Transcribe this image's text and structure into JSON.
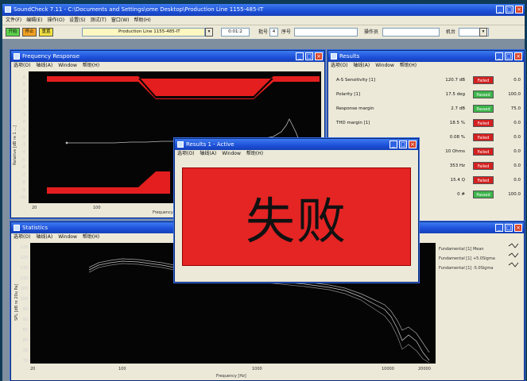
{
  "app": {
    "title": "SoundCheck 7.11 - C:\\Documents and Settings\\ome Desktop\\Production Line 1155-485-IT",
    "menu": [
      "文件(F)",
      "编辑(E)",
      "操作(O)",
      "设置(S)",
      "测试(T)",
      "窗口(W)",
      "帮助(H)"
    ]
  },
  "toolbar": {
    "run_label": "开始",
    "stop_label": "停止",
    "reset_label": "重置",
    "sequence_value": "Production Line 1155-485-IT",
    "time_value": "0:01:2",
    "batch_label": "批号",
    "batch_value": "4",
    "serial_label": "序号",
    "operator_label": "操作员",
    "station_label": "机台"
  },
  "colors": {
    "title_blue": "#1c4fd8",
    "window_bg": "#ece9d8",
    "fail_red": "#d42020",
    "pass_green": "#3bb449",
    "plot_bg": "#050505"
  },
  "freq_window": {
    "title": "Frequency Response",
    "menu": [
      "选项(O)",
      "轴线(A)",
      "Window",
      "帮助(H)"
    ],
    "y_ticks": [
      "6",
      "5",
      "4",
      "3",
      "2",
      "1",
      "0",
      "-1",
      "-2",
      "-3",
      "-4",
      "-5",
      "-6",
      "-7",
      "-8",
      "-9",
      "-10"
    ],
    "x_ticks": [
      "20",
      "100"
    ],
    "ylabel": "Relative [dB re 1 ...]",
    "xlabel": "Frequency"
  },
  "results_window": {
    "title": "Results",
    "menu": [
      "选项(O)",
      "轴线(A)",
      "Window",
      "帮助(H)"
    ],
    "rows": [
      {
        "name": "A-S Sensitivity [1]",
        "value": "120.7 dB",
        "status": "Failed",
        "pct": "0.0",
        "unit": "%"
      },
      {
        "name": "Polarity [1]",
        "value": "17.5 deg",
        "status": "Passed",
        "pct": "100.0",
        "unit": "%"
      },
      {
        "name": "Response margin",
        "value": "2.7 dB",
        "status": "Passed",
        "pct": "75.0",
        "unit": "%"
      },
      {
        "name": "THD margin [1]",
        "value": "18.5 %",
        "status": "Failed",
        "pct": "0.0",
        "unit": "%"
      },
      {
        "name": "",
        "value": "0.08 %",
        "status": "Failed",
        "pct": "0.0",
        "unit": "%"
      },
      {
        "name": "",
        "value": "10 Ohms",
        "status": "Failed",
        "pct": "0.0",
        "unit": "%"
      },
      {
        "name": "",
        "value": "353 Hz",
        "status": "Failed",
        "pct": "0.0",
        "unit": "%"
      },
      {
        "name": "",
        "value": "15.4 Q",
        "status": "Failed",
        "pct": "0.0",
        "unit": "%"
      },
      {
        "name": "",
        "value": "0 #",
        "status": "Passed",
        "pct": "100.0",
        "unit": "%"
      }
    ]
  },
  "stats_window": {
    "title": "Statistics",
    "menu": [
      "选项(O)",
      "轴线(A)",
      "Window",
      "帮助(H)"
    ],
    "y_ticks": [
      "125",
      "120",
      "115",
      "110",
      "105",
      "100",
      "95",
      "90",
      "85",
      "80",
      "75",
      "70"
    ],
    "x_ticks": [
      "20",
      "100",
      "1000",
      "10000",
      "20000"
    ],
    "ylabel": "SPL [dB re 20u Pa]",
    "xlabel": "Frequency [Hz]",
    "legend": [
      "Fundamental [1] Mean",
      "Fundamental [1] +5.0Sigma",
      "Fundamental [1] -5.0Sigma"
    ]
  },
  "popup": {
    "title": "Results 1 - Active",
    "menu": [
      "选项(O)",
      "轴线(A)",
      "Window",
      "帮助(H)"
    ],
    "verdict": "失败"
  }
}
